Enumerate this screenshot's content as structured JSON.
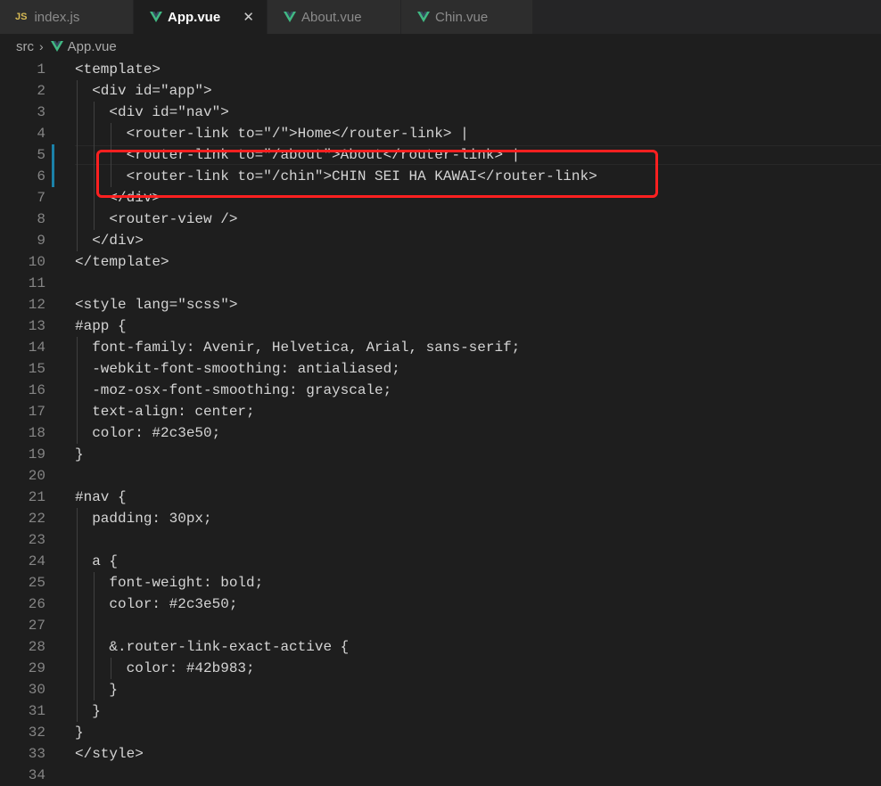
{
  "tabs": [
    {
      "label": "index.js",
      "icon": "js-icon",
      "icon_text": "JS",
      "active": false
    },
    {
      "label": "App.vue",
      "icon": "vue-icon",
      "active": true,
      "close": "✕"
    },
    {
      "label": "About.vue",
      "icon": "vue-icon",
      "active": false
    },
    {
      "label": "Chin.vue",
      "icon": "vue-icon",
      "active": false
    }
  ],
  "breadcrumb": {
    "folder": "src",
    "separator": "›",
    "file": "App.vue"
  },
  "colors": {
    "background": "#1e1e1e",
    "line_numbers": "#858585",
    "text": "#d4d4d4",
    "vue_green": "#41b883",
    "highlight_border": "#ff2020",
    "modified_gutter": "#1b81a8"
  },
  "lines": [
    {
      "n": "1",
      "text": "<template>"
    },
    {
      "n": "2",
      "text": "  <div id=\"app\">"
    },
    {
      "n": "3",
      "text": "    <div id=\"nav\">"
    },
    {
      "n": "4",
      "text": "      <router-link to=\"/\">Home</router-link> |"
    },
    {
      "n": "5",
      "text": "      <router-link to=\"/about\">About</router-link> |"
    },
    {
      "n": "6",
      "text": "      <router-link to=\"/chin\">CHIN SEI HA KAWAI</router-link>"
    },
    {
      "n": "7",
      "text": "    </div>"
    },
    {
      "n": "8",
      "text": "    <router-view />"
    },
    {
      "n": "9",
      "text": "  </div>"
    },
    {
      "n": "10",
      "text": "</template>"
    },
    {
      "n": "11",
      "text": ""
    },
    {
      "n": "12",
      "text": "<style lang=\"scss\">"
    },
    {
      "n": "13",
      "text": "#app {"
    },
    {
      "n": "14",
      "text": "  font-family: Avenir, Helvetica, Arial, sans-serif;"
    },
    {
      "n": "15",
      "text": "  -webkit-font-smoothing: antialiased;"
    },
    {
      "n": "16",
      "text": "  -moz-osx-font-smoothing: grayscale;"
    },
    {
      "n": "17",
      "text": "  text-align: center;"
    },
    {
      "n": "18",
      "text": "  color: #2c3e50;"
    },
    {
      "n": "19",
      "text": "}"
    },
    {
      "n": "20",
      "text": ""
    },
    {
      "n": "21",
      "text": "#nav {"
    },
    {
      "n": "22",
      "text": "  padding: 30px;"
    },
    {
      "n": "23",
      "text": ""
    },
    {
      "n": "24",
      "text": "  a {"
    },
    {
      "n": "25",
      "text": "    font-weight: bold;"
    },
    {
      "n": "26",
      "text": "    color: #2c3e50;"
    },
    {
      "n": "27",
      "text": ""
    },
    {
      "n": "28",
      "text": "    &.router-link-exact-active {"
    },
    {
      "n": "29",
      "text": "      color: #42b983;"
    },
    {
      "n": "30",
      "text": "    }"
    },
    {
      "n": "31",
      "text": "  }"
    },
    {
      "n": "32",
      "text": "}"
    },
    {
      "n": "33",
      "text": "</style>"
    },
    {
      "n": "34",
      "text": ""
    }
  ]
}
